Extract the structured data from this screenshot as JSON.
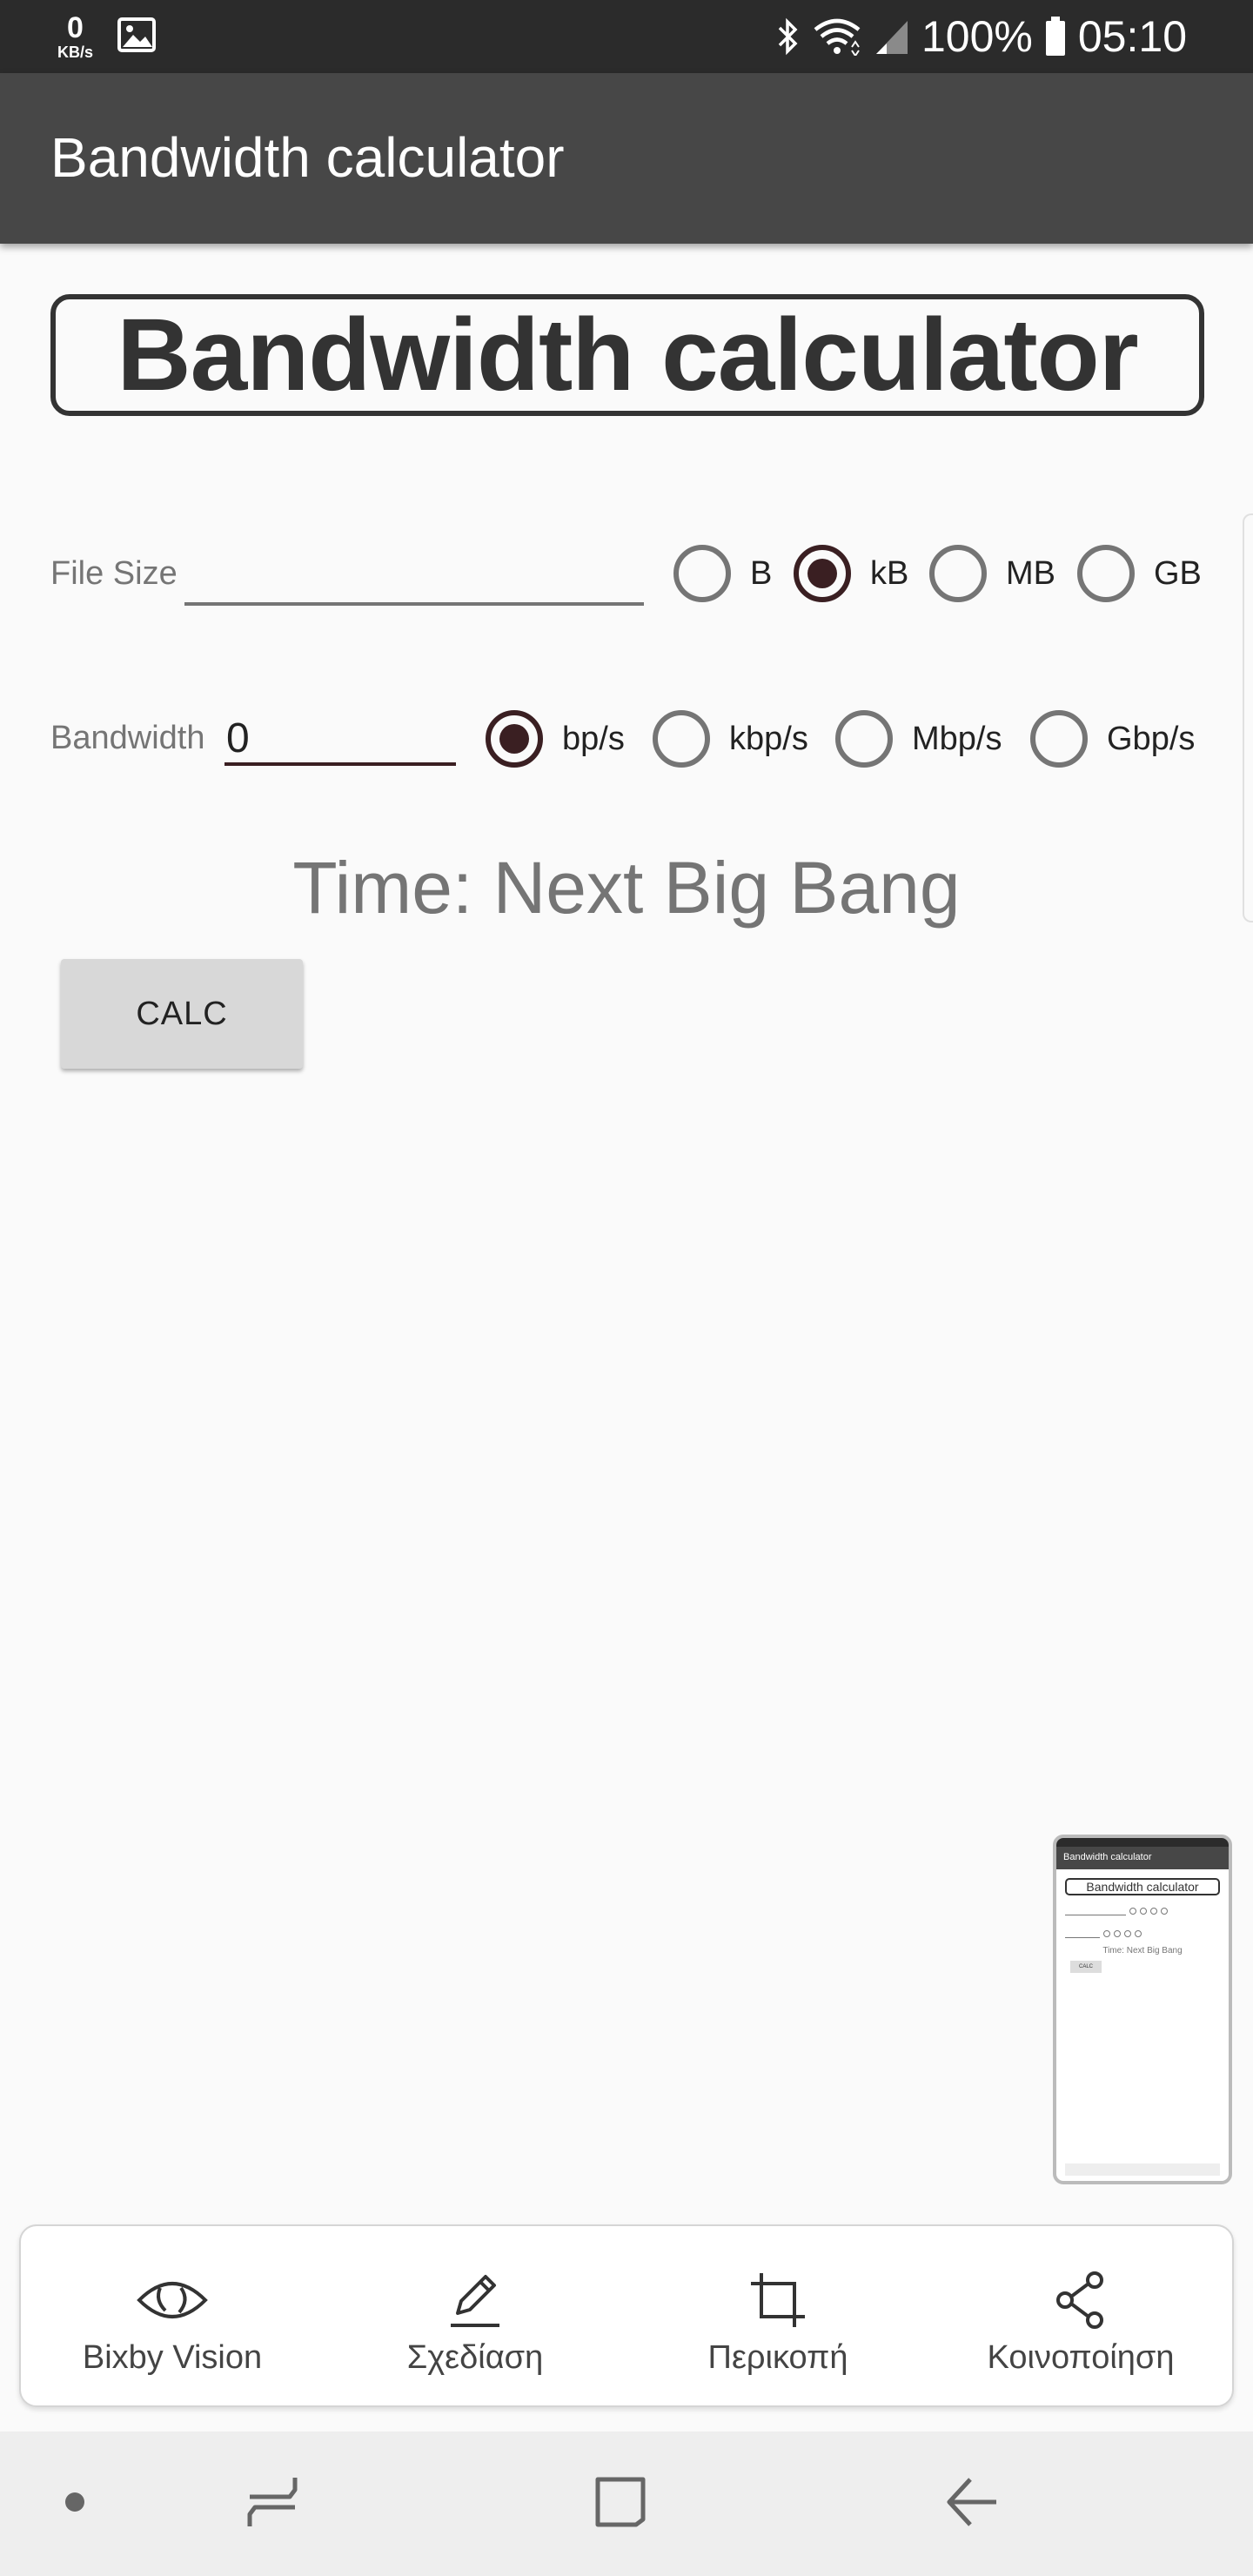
{
  "status_bar": {
    "net_speed_value": "0",
    "net_speed_unit": "KB/s",
    "battery_percent": "100%",
    "time": "05:10",
    "icons": [
      "gallery-icon",
      "bluetooth-icon",
      "wifi-icon",
      "signal-icon",
      "battery-icon"
    ]
  },
  "app_bar": {
    "title": "Bandwidth calculator"
  },
  "main": {
    "headline": "Bandwidth calculator",
    "file_size": {
      "label": "File Size",
      "value": "",
      "units": [
        "B",
        "kB",
        "MB",
        "GB"
      ],
      "selected_unit": "kB"
    },
    "bandwidth": {
      "label": "Bandwidth",
      "value": "0",
      "units": [
        "bp/s",
        "kbp/s",
        "Mbp/s",
        "Gbp/s"
      ],
      "selected_unit": "bp/s"
    },
    "result": "Time: Next Big Bang",
    "calc_button": "CALC"
  },
  "screenshot_toolbar": {
    "items": [
      {
        "label": "Bixby Vision",
        "icon": "eye-icon"
      },
      {
        "label": "Σχεδίαση",
        "icon": "pencil-icon"
      },
      {
        "label": "Περικοπή",
        "icon": "crop-icon"
      },
      {
        "label": "Κοινοποίηση",
        "icon": "share-icon"
      }
    ]
  },
  "nav_bar": {
    "icons": [
      "dot-icon",
      "recents-icon",
      "home-icon",
      "back-icon"
    ]
  },
  "colors": {
    "status_bar": "#2b2b2b",
    "app_bar": "#474747",
    "accent": "#3a1f22",
    "background": "#fafafa"
  }
}
